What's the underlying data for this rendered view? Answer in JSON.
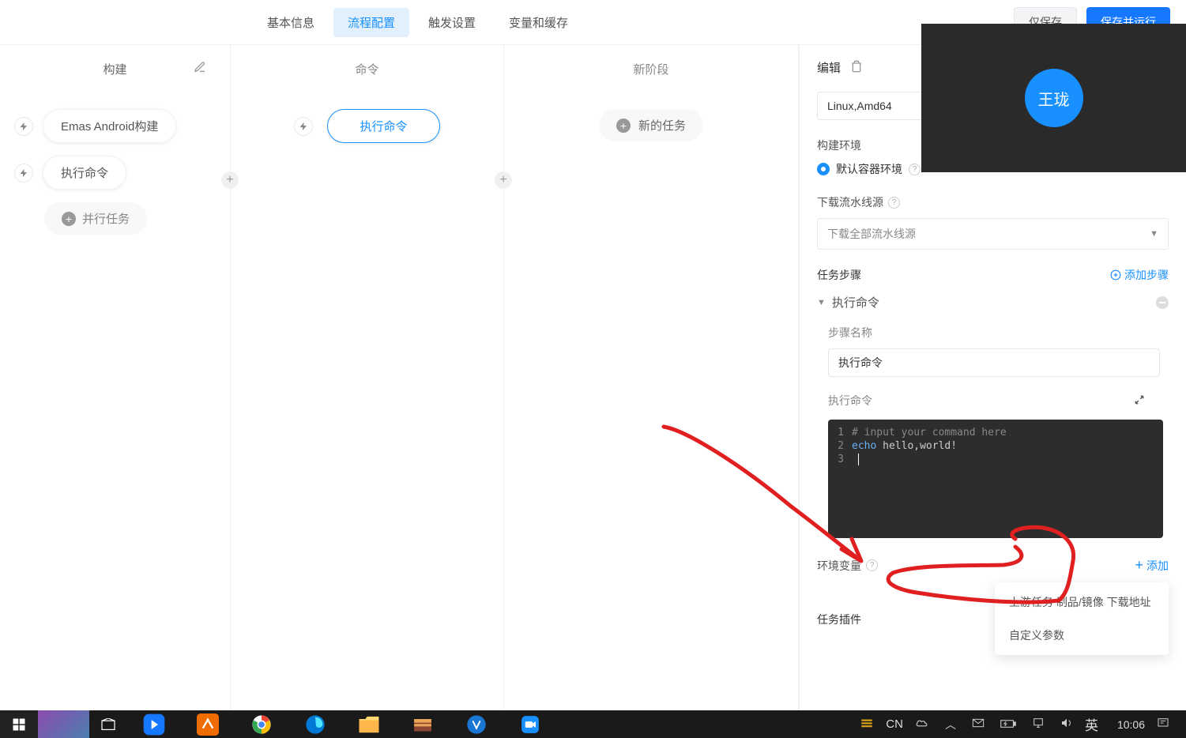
{
  "header": {
    "tabs": [
      "基本信息",
      "流程配置",
      "触发设置",
      "变量和缓存"
    ],
    "active_tab_index": 1,
    "buttons": {
      "save_only": "仅保存",
      "save_run": "保存并运行"
    }
  },
  "canvas": {
    "col1": {
      "title": "构建",
      "nodes": [
        "Emas Android构建",
        "执行命令"
      ],
      "parallel_btn": "并行任务"
    },
    "col2": {
      "title": "命令",
      "active_node": "执行命令"
    },
    "col3": {
      "title": "新阶段",
      "new_task_btn": "新的任务"
    }
  },
  "panel": {
    "edit_label": "编辑",
    "platform_value": "Linux,Amd64",
    "build_env": {
      "label": "构建环境",
      "option": "默认容器环境"
    },
    "download_source": {
      "label": "下载流水线源",
      "placeholder": "下载全部流水线源"
    },
    "task_steps": {
      "label": "任务步骤",
      "add_btn": "添加步骤"
    },
    "step": {
      "title": "执行命令",
      "name_label": "步骤名称",
      "name_value": "执行命令",
      "cmd_label": "执行命令",
      "code_lines": {
        "l1": "# input your command here",
        "l2_keyword": "echo",
        "l2_rest": " hello,world!"
      }
    },
    "env_vars": {
      "label": "环境变量",
      "add_btn": "添加"
    },
    "dropdown": {
      "item1": "上游任务 制品/镜像 下载地址",
      "item2": "自定义参数"
    },
    "plugins": {
      "label": "任务插件",
      "partial": "件"
    }
  },
  "overlay": {
    "avatar_text": "王珑"
  },
  "taskbar": {
    "ime_lang": "CN",
    "ime_mode": "英",
    "clock": "10:06"
  },
  "colors": {
    "primary": "#1890ff",
    "annotation": "#e02020"
  }
}
